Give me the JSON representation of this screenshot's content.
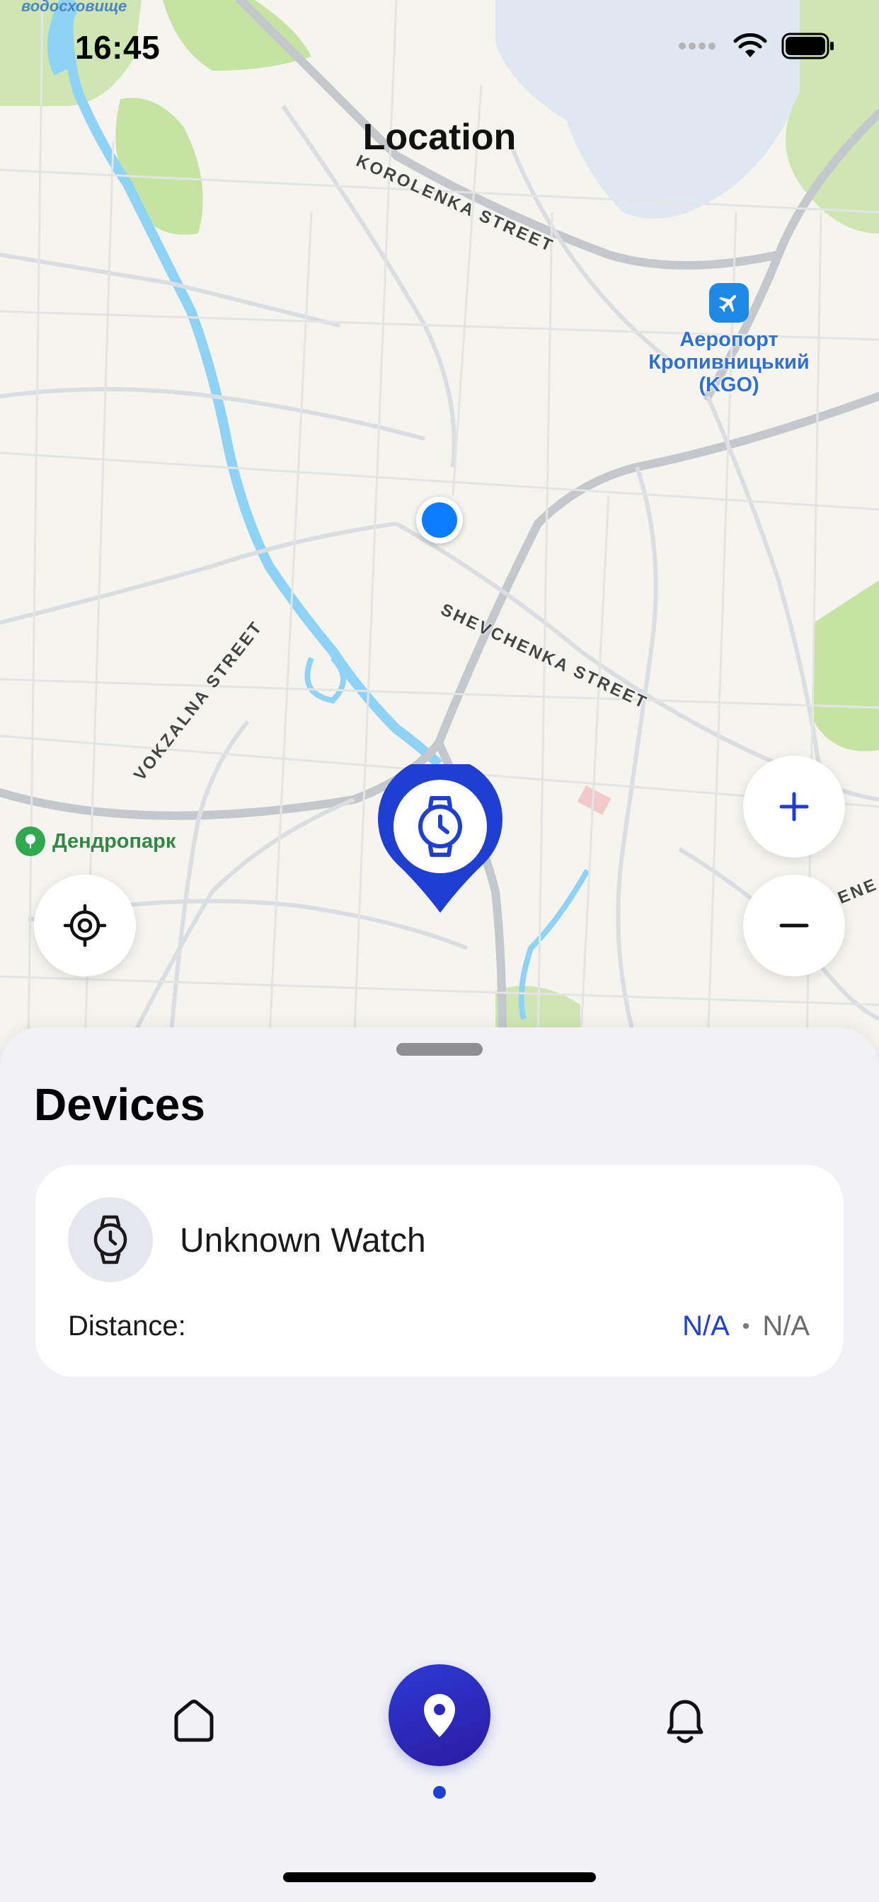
{
  "status_bar": {
    "time": "16:45"
  },
  "header": {
    "title": "Location"
  },
  "map": {
    "street_labels": {
      "korolenka": "KOROLENKA STREET",
      "shevchenka": "SHEVCHENKA STREET",
      "vokzalna": "VOKZALNA STREET",
      "edge": "ENE"
    },
    "reservoir_label": "водосховище",
    "poi_airport": "Аеропорт\nКропивницький\n(KGO)",
    "poi_park": "Дендропарк",
    "icons": {
      "recenter": "crosshair-icon",
      "zoom_in": "plus-icon",
      "zoom_out": "minus-icon",
      "device_pin": "watch-pin-icon",
      "airport": "airplane-icon",
      "park": "tree-icon"
    }
  },
  "sheet": {
    "title": "Devices",
    "devices": [
      {
        "name": "Unknown Watch",
        "icon": "watch-icon",
        "distance_label": "Distance:",
        "distance_value": "N/A",
        "separator": "•",
        "secondary_value": "N/A"
      }
    ]
  },
  "tab_bar": {
    "items": [
      {
        "icon": "home-icon",
        "active": false
      },
      {
        "icon": "location-pin-icon",
        "active": true
      },
      {
        "icon": "bell-icon",
        "active": false
      }
    ]
  },
  "colors": {
    "accent": "#1f3fd3",
    "user_location": "#0a7cff",
    "sheet_bg": "#f1f1f6",
    "map_water": "#8ed3f5"
  }
}
